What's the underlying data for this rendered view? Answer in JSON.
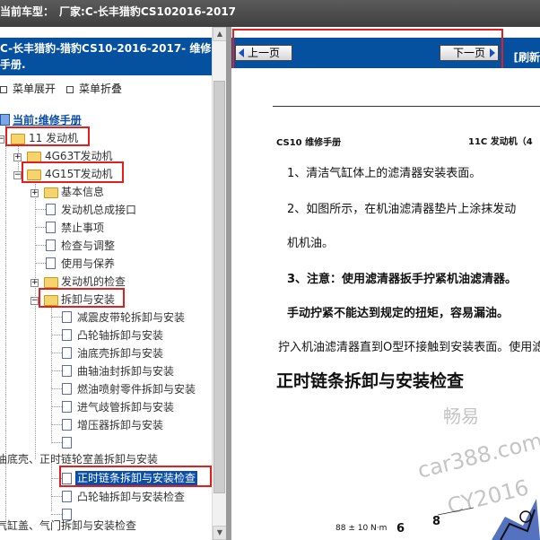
{
  "titlebar": {
    "label": "当前车型：",
    "value": "厂家:C-长丰猎豹CS102016-2017"
  },
  "left_panel": {
    "header": "C-长丰猎豹-猎豹CS10-2016-2017- 维修手册.",
    "expand_all": "菜单展开",
    "collapse_all": "菜单折叠"
  },
  "tree": {
    "current": "当前:维修手册",
    "nodes": [
      {
        "label": "11 发动机"
      },
      {
        "label": "4G63T发动机"
      },
      {
        "label": "4G15T发动机"
      },
      {
        "label": "基本信息"
      },
      {
        "label": "发动机总成接口"
      },
      {
        "label": "禁止事项"
      },
      {
        "label": "检查与调整"
      },
      {
        "label": "使用与保养"
      },
      {
        "label": "发动机的检查"
      },
      {
        "label": "拆卸与安装"
      },
      {
        "label": "减震皮带轮拆卸与安装"
      },
      {
        "label": "凸轮轴拆卸与安装"
      },
      {
        "label": "油底壳拆卸与安装"
      },
      {
        "label": "曲轴油封拆卸与安装"
      },
      {
        "label": "燃油喷射零件拆卸与安装"
      },
      {
        "label": "进气歧管拆卸与安装"
      },
      {
        "label": "增压器拆卸与安装"
      },
      {
        "label": ""
      },
      {
        "label": "油底壳、正时链轮室盖拆卸与安装"
      },
      {
        "label": "正时链条拆卸与安装检查"
      },
      {
        "label": "凸轮轴拆卸与安装检查"
      },
      {
        "label": ""
      },
      {
        "label": "气缸盖、气门拆卸与安装检查"
      }
    ]
  },
  "nav": {
    "prev": "上一页",
    "next": "下一页",
    "refresh": "[刷新"
  },
  "document": {
    "header_left": "CS10 维修手册",
    "header_right": "11C 发动机（4",
    "step1": "1、清洁气缸体上的滤清器安装表面。",
    "step2": "2、如图所示，在机油滤清器垫片上涂抹发动",
    "step2b": "机机油。",
    "step3": "3、注意：使用滤清器扳手拧紧机油滤清器。",
    "step3b": "手动拧紧不能达到规定的扭矩，容易漏油。",
    "step4": "拧入机油滤清器直到O型环接触到安装表面。使用滤",
    "section_title": "正时链条拆卸与安装检查",
    "torque": "88 ± 10 N·m",
    "callout1": "6",
    "callout2": "8"
  },
  "watermark": {
    "line1": "畅易",
    "line2": "car388.com",
    "line3": "CY2016"
  },
  "colors": {
    "accent": "#05509f",
    "highlight": "#e02020",
    "selected": "#0a4ea8"
  }
}
